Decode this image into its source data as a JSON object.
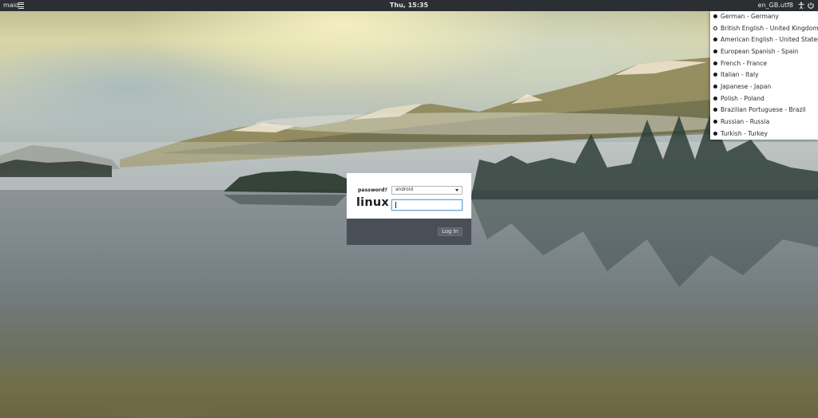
{
  "top_panel": {
    "host_name": "maid",
    "clock": "Thu, 15:35",
    "locale": "en_GB.utf8",
    "icons": [
      "menu-icon",
      "accessibility-icon",
      "power-icon"
    ]
  },
  "language_menu": {
    "items": [
      {
        "label": "German - Germany",
        "selected": false
      },
      {
        "label": "British English - United Kingdom",
        "selected": true
      },
      {
        "label": "American English - United States",
        "selected": false
      },
      {
        "label": "European Spanish - Spain",
        "selected": false
      },
      {
        "label": "French - France",
        "selected": false
      },
      {
        "label": "Italian - Italy",
        "selected": false
      },
      {
        "label": "Japanese - Japan",
        "selected": false
      },
      {
        "label": "Polish - Poland",
        "selected": false
      },
      {
        "label": "Brazilian Portuguese - Brazil",
        "selected": false
      },
      {
        "label": "Russian - Russia",
        "selected": false
      },
      {
        "label": "Turkish - Turkey",
        "selected": false
      }
    ]
  },
  "login": {
    "prompt_label": "password?",
    "user_select_value": "android",
    "host_logo_text": "linux",
    "password_value": "",
    "login_button_label": "Log In"
  },
  "colors": {
    "panel_bg": "#2b2e33",
    "footer_bg": "#4a4e57",
    "input_focus": "#6fa5d8"
  }
}
